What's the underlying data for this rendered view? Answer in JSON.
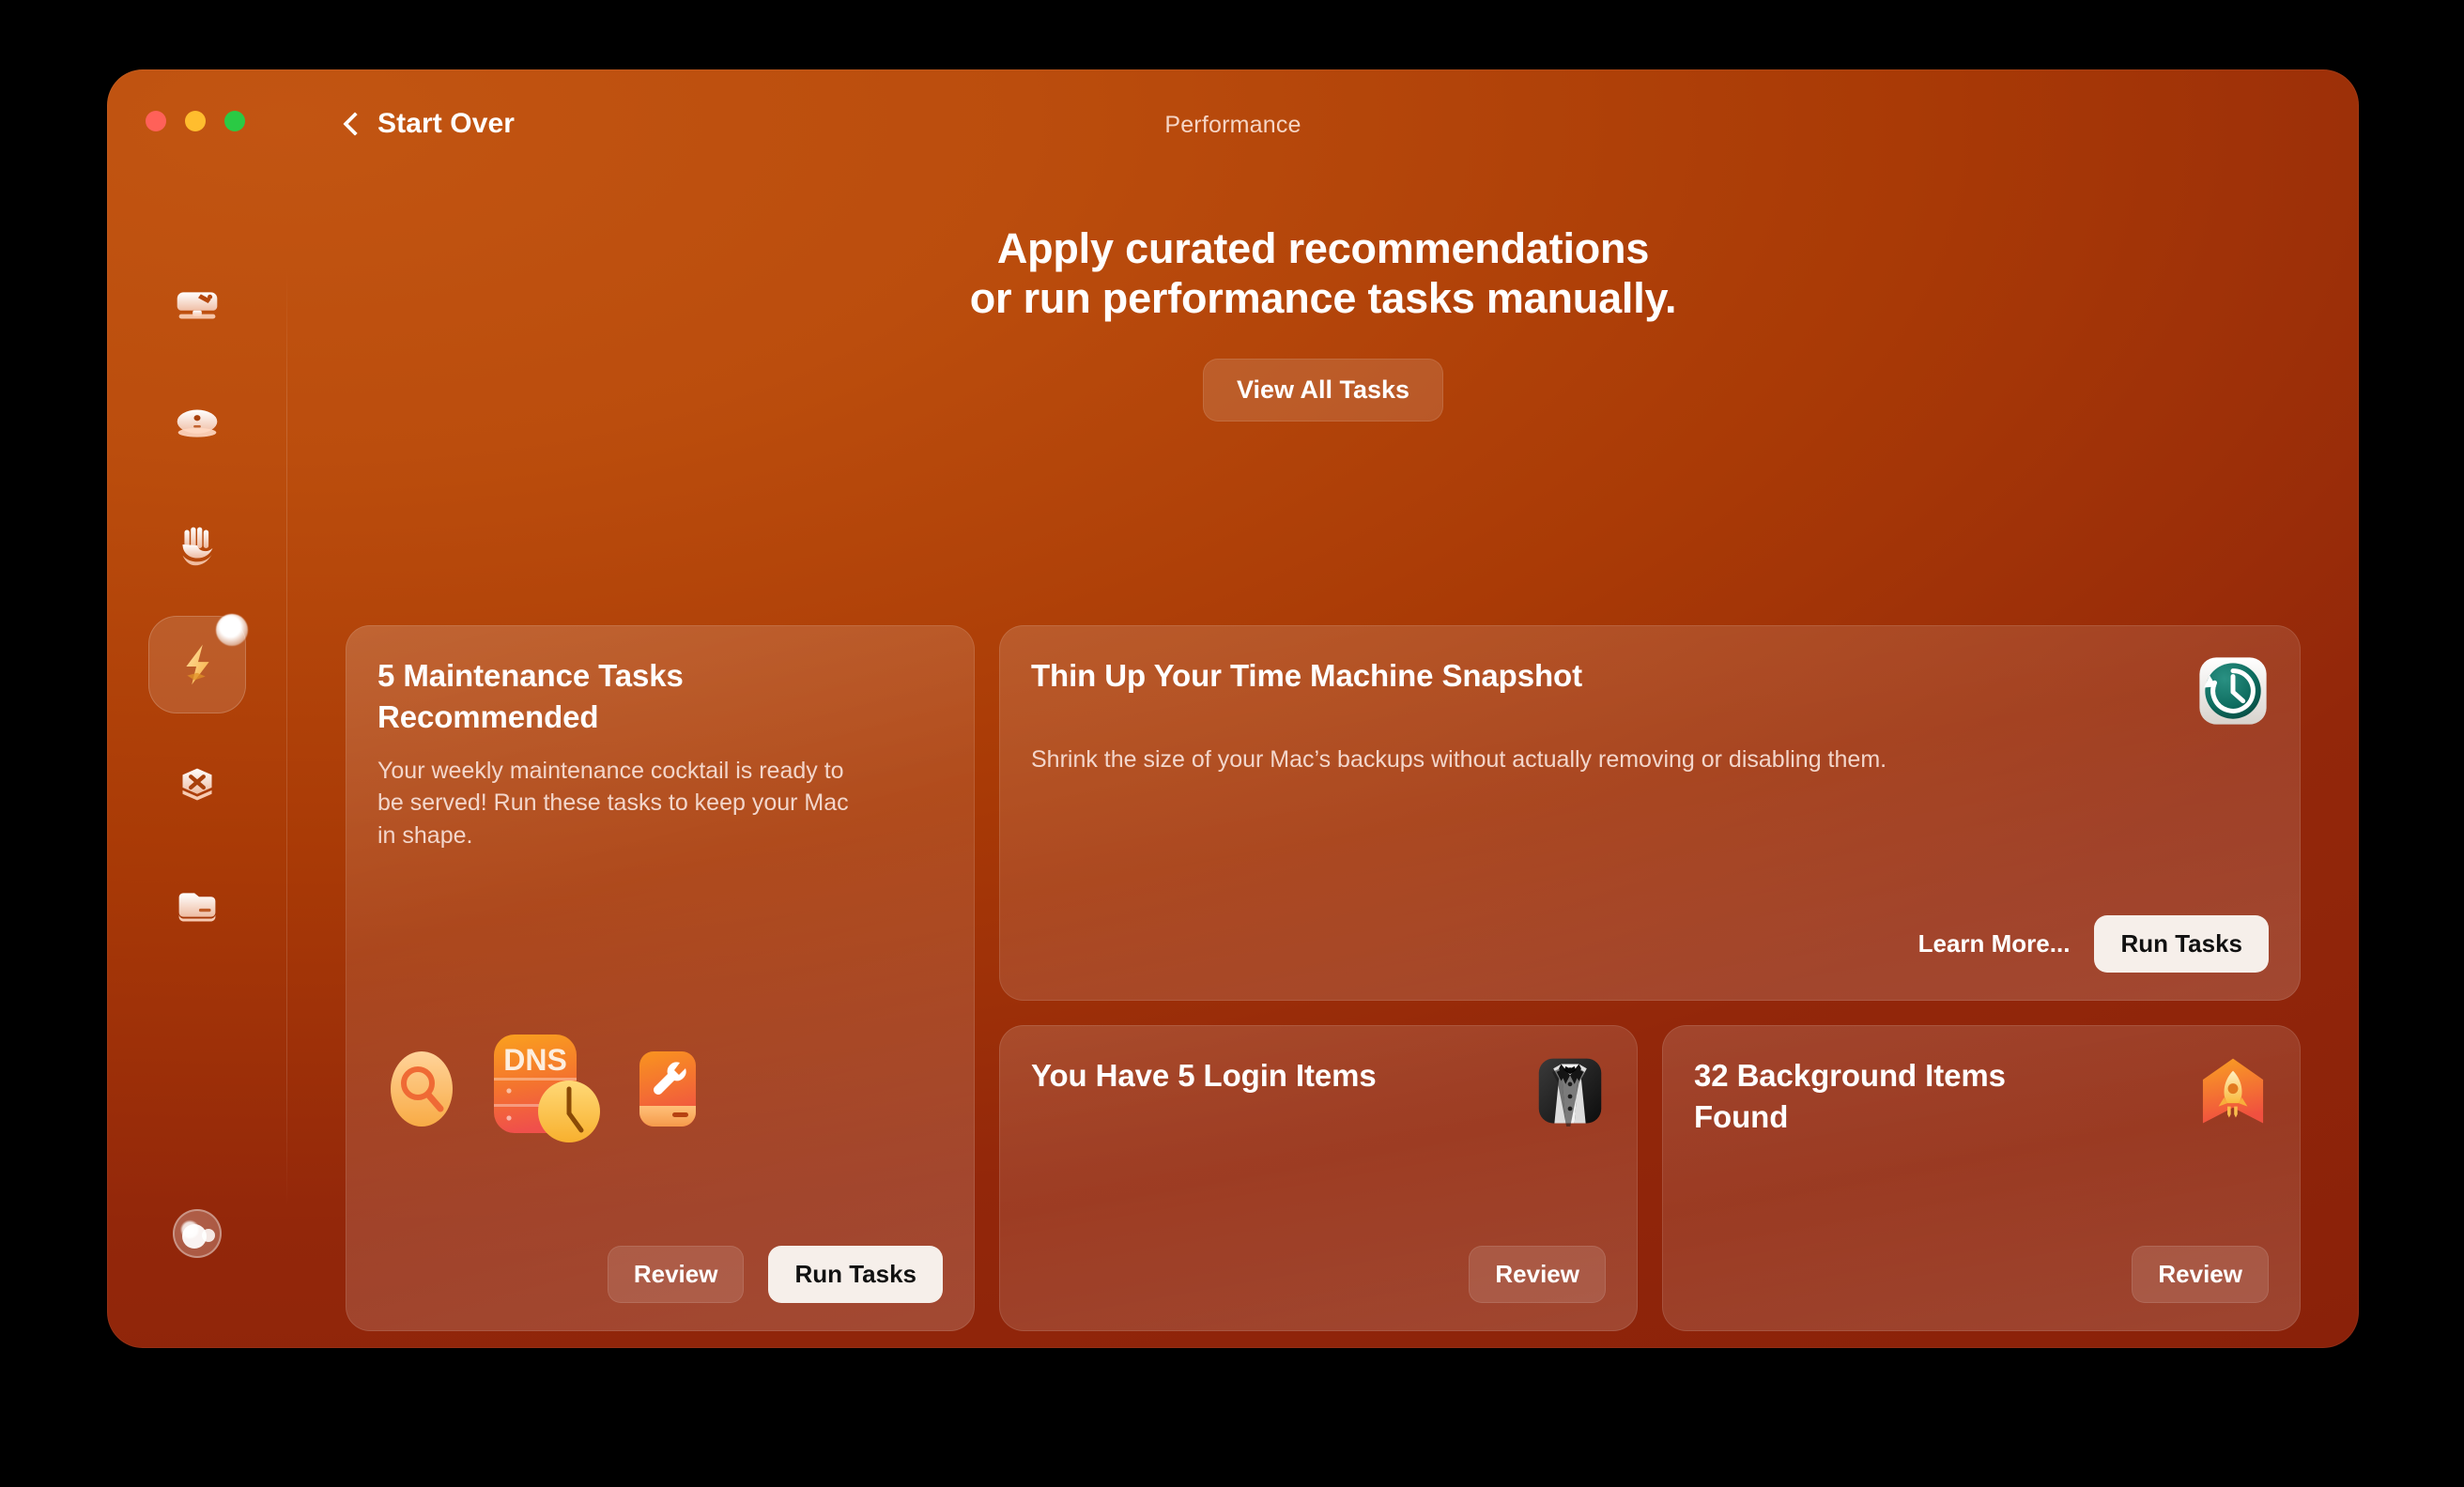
{
  "window": {
    "title": "Performance",
    "back_label": "Start Over",
    "traffic_lights": {
      "close": "close-button",
      "minimize": "minimize-button",
      "zoom": "zoom-button"
    }
  },
  "sidebar": {
    "items": [
      {
        "icon": "smart-care-icon",
        "name": "sidebar-item-smart-care",
        "selected": false,
        "badge": false
      },
      {
        "icon": "cleanup-icon",
        "name": "sidebar-item-cleanup",
        "selected": false,
        "badge": false
      },
      {
        "icon": "protection-icon",
        "name": "sidebar-item-protection",
        "selected": false,
        "badge": false
      },
      {
        "icon": "performance-icon",
        "name": "sidebar-item-performance",
        "selected": true,
        "badge": true
      },
      {
        "icon": "applications-icon",
        "name": "sidebar-item-applications",
        "selected": false,
        "badge": false
      },
      {
        "icon": "my-clutter-icon",
        "name": "sidebar-item-my-clutter",
        "selected": false,
        "badge": false
      }
    ],
    "account": {
      "icon": "account-avatar-icon",
      "name": "account-avatar"
    }
  },
  "hero": {
    "headline_line1": "Apply curated recommendations",
    "headline_line2": "or run performance tasks manually.",
    "view_all_label": "View All Tasks"
  },
  "cards": {
    "maintenance": {
      "title_line1": "5 Maintenance Tasks",
      "title_line2": "Recommended",
      "description": "Your weekly maintenance cocktail is ready to be served! Run these tasks to keep your Mac in shape.",
      "task_icons": [
        "spotlight-index-icon",
        "dns-cache-icon",
        "disk-repair-icon"
      ],
      "review_label": "Review",
      "run_label": "Run Tasks"
    },
    "time_machine": {
      "title": "Thin Up Your Time Machine Snapshot",
      "description": "Shrink the size of your Mac’s backups without actually removing or disabling them.",
      "icon": "time-machine-icon",
      "learn_more_label": "Learn More...",
      "run_label": "Run Tasks"
    },
    "login_items": {
      "title": "You Have 5 Login Items",
      "icon": "tuxedo-login-items-icon",
      "review_label": "Review"
    },
    "background_items": {
      "title_line1": "32 Background Items",
      "title_line2": "Found",
      "icon": "rocket-background-items-icon",
      "review_label": "Review"
    }
  },
  "colors": {
    "window_bg_start": "#c25512",
    "window_bg_end": "#8a2109",
    "accent_orange": "#f08a2b",
    "primary_button_bg": "#f6efea",
    "title_text": "#f6d5c5",
    "body_text": "#f3d6cb",
    "time_machine_teal": "#0d6b5f",
    "traffic_red": "#ff6159",
    "traffic_yellow": "#ffbd2e",
    "traffic_green": "#2aca44"
  }
}
